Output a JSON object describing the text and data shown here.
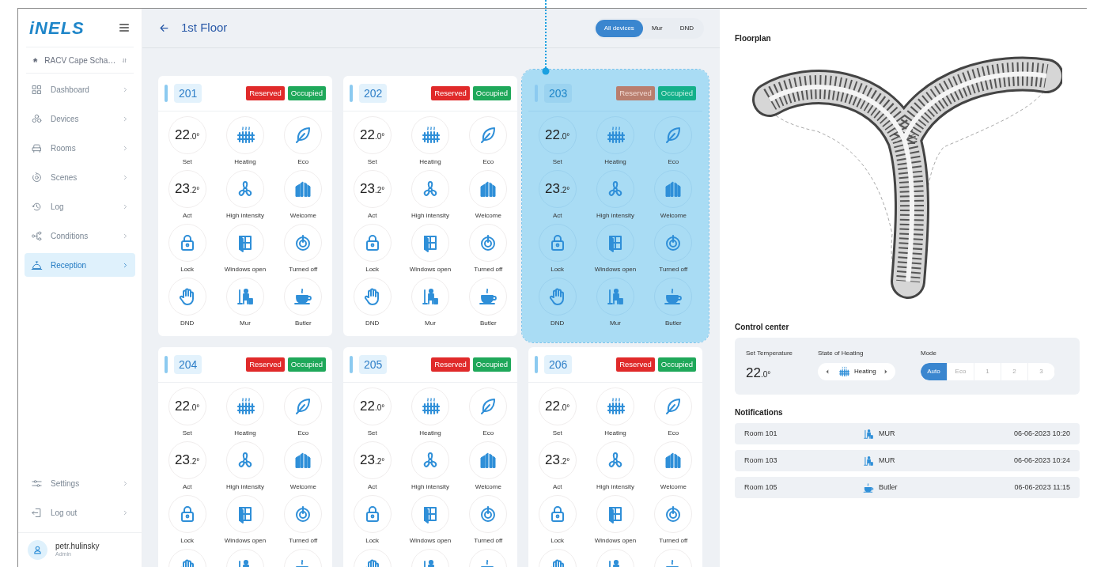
{
  "sidebar": {
    "logo": "iNELS",
    "site": "RACV Cape Scha…",
    "nav": [
      {
        "label": "Dashboard",
        "kind": "grid",
        "selected": false
      },
      {
        "label": "Devices",
        "kind": "devices",
        "selected": false
      },
      {
        "label": "Rooms",
        "kind": "armchair",
        "selected": false
      },
      {
        "label": "Scenes",
        "kind": "scenes",
        "selected": false
      },
      {
        "label": "Log",
        "kind": "clock",
        "selected": false
      },
      {
        "label": "Conditions",
        "kind": "nodes",
        "selected": false
      },
      {
        "label": "Reception",
        "kind": "bell",
        "selected": true
      }
    ],
    "bottom_nav": [
      {
        "label": "Settings",
        "kind": "sliders"
      },
      {
        "label": "Log out",
        "kind": "logout"
      }
    ],
    "user": {
      "name": "petr.hulinsky",
      "role": "Admin"
    }
  },
  "header": {
    "title": "1st Floor",
    "filters": [
      {
        "label": "All devices",
        "selected": true
      },
      {
        "label": "Mur",
        "selected": false
      },
      {
        "label": "DND",
        "selected": false
      }
    ]
  },
  "rooms": [
    {
      "number": "201",
      "highlighted": false,
      "badges": [
        {
          "label": "Reserved",
          "kind": "reserved"
        },
        {
          "label": "Occupied",
          "kind": "occupied"
        }
      ],
      "tiles": [
        {
          "kind": "temperature",
          "whole": "22",
          "fraction": ".0°",
          "label": "Set"
        },
        {
          "kind": "heating",
          "label": "Heating"
        },
        {
          "kind": "leaf",
          "label": "Eco"
        },
        {
          "kind": "temperature",
          "whole": "23",
          "fraction": ".2°",
          "label": "Act"
        },
        {
          "kind": "fan",
          "label": "High intensity"
        },
        {
          "kind": "doors",
          "label": "Welcome"
        },
        {
          "kind": "lock",
          "label": "Lock"
        },
        {
          "kind": "window",
          "label": "Windows open"
        },
        {
          "kind": "power",
          "label": "Turned off"
        },
        {
          "kind": "hand",
          "label": "DND"
        },
        {
          "kind": "mur",
          "label": "Mur"
        },
        {
          "kind": "cup",
          "label": "Butler"
        }
      ]
    },
    {
      "number": "202",
      "highlighted": false,
      "badges": [
        {
          "label": "Reserved",
          "kind": "reserved"
        },
        {
          "label": "Occupied",
          "kind": "occupied"
        }
      ],
      "tiles": [
        {
          "kind": "temperature",
          "whole": "22",
          "fraction": ".0°",
          "label": "Set"
        },
        {
          "kind": "heating",
          "label": "Heating"
        },
        {
          "kind": "leaf",
          "label": "Eco"
        },
        {
          "kind": "temperature",
          "whole": "23",
          "fraction": ".2°",
          "label": "Act"
        },
        {
          "kind": "fan",
          "label": "High intensity"
        },
        {
          "kind": "doors",
          "label": "Welcome"
        },
        {
          "kind": "lock",
          "label": "Lock"
        },
        {
          "kind": "window",
          "label": "Windows open"
        },
        {
          "kind": "power",
          "label": "Turned off"
        },
        {
          "kind": "hand",
          "label": "DND"
        },
        {
          "kind": "mur",
          "label": "Mur"
        },
        {
          "kind": "cup",
          "label": "Butler"
        }
      ]
    },
    {
      "number": "203",
      "highlighted": true,
      "badges": [
        {
          "label": "Reserved",
          "kind": "reserved"
        },
        {
          "label": "Occupied",
          "kind": "occupied"
        }
      ],
      "tiles": [
        {
          "kind": "temperature",
          "whole": "22",
          "fraction": ".0°",
          "label": "Set"
        },
        {
          "kind": "heating",
          "label": "Heating"
        },
        {
          "kind": "leaf",
          "label": "Eco"
        },
        {
          "kind": "temperature",
          "whole": "23",
          "fraction": ".2°",
          "label": "Act"
        },
        {
          "kind": "fan",
          "label": "High intensity"
        },
        {
          "kind": "doors",
          "label": "Welcome"
        },
        {
          "kind": "lock",
          "label": "Lock"
        },
        {
          "kind": "window",
          "label": "Windows open"
        },
        {
          "kind": "power",
          "label": "Turned off"
        },
        {
          "kind": "hand",
          "label": "DND"
        },
        {
          "kind": "mur",
          "label": "Mur"
        },
        {
          "kind": "cup",
          "label": "Butler"
        }
      ]
    },
    {
      "number": "204",
      "highlighted": false,
      "badges": [
        {
          "label": "Reserved",
          "kind": "reserved"
        },
        {
          "label": "Occupied",
          "kind": "occupied"
        }
      ],
      "tiles": [
        {
          "kind": "temperature",
          "whole": "22",
          "fraction": ".0°",
          "label": "Set"
        },
        {
          "kind": "heating",
          "label": "Heating"
        },
        {
          "kind": "leaf",
          "label": "Eco"
        },
        {
          "kind": "temperature",
          "whole": "23",
          "fraction": ".2°",
          "label": "Act"
        },
        {
          "kind": "fan",
          "label": "High intensity"
        },
        {
          "kind": "doors",
          "label": "Welcome"
        },
        {
          "kind": "lock",
          "label": "Lock"
        },
        {
          "kind": "window",
          "label": "Windows open"
        },
        {
          "kind": "power",
          "label": "Turned off"
        },
        {
          "kind": "hand"
        },
        {
          "kind": "mur"
        },
        {
          "kind": "cup"
        }
      ]
    },
    {
      "number": "205",
      "highlighted": false,
      "badges": [
        {
          "label": "Reserved",
          "kind": "reserved"
        },
        {
          "label": "Occupied",
          "kind": "occupied"
        }
      ],
      "tiles": [
        {
          "kind": "temperature",
          "whole": "22",
          "fraction": ".0°",
          "label": "Set"
        },
        {
          "kind": "heating",
          "label": "Heating"
        },
        {
          "kind": "leaf",
          "label": "Eco"
        },
        {
          "kind": "temperature",
          "whole": "23",
          "fraction": ".2°",
          "label": "Act"
        },
        {
          "kind": "fan",
          "label": "High intensity"
        },
        {
          "kind": "doors",
          "label": "Welcome"
        },
        {
          "kind": "lock",
          "label": "Lock"
        },
        {
          "kind": "window",
          "label": "Windows open"
        },
        {
          "kind": "power",
          "label": "Turned off"
        },
        {
          "kind": "hand"
        },
        {
          "kind": "mur"
        },
        {
          "kind": "cup"
        }
      ]
    },
    {
      "number": "206",
      "highlighted": false,
      "badges": [
        {
          "label": "Reserved",
          "kind": "reserved"
        },
        {
          "label": "Occupied",
          "kind": "occupied"
        }
      ],
      "tiles": [
        {
          "kind": "temperature",
          "whole": "22",
          "fraction": ".0°",
          "label": "Set"
        },
        {
          "kind": "heating",
          "label": "Heating"
        },
        {
          "kind": "leaf",
          "label": "Eco"
        },
        {
          "kind": "temperature",
          "whole": "23",
          "fraction": ".2°",
          "label": "Act"
        },
        {
          "kind": "fan",
          "label": "High intensity"
        },
        {
          "kind": "doors",
          "label": "Welcome"
        },
        {
          "kind": "lock",
          "label": "Lock"
        },
        {
          "kind": "window",
          "label": "Windows open"
        },
        {
          "kind": "power",
          "label": "Turned off"
        },
        {
          "kind": "hand"
        },
        {
          "kind": "mur"
        },
        {
          "kind": "cup"
        }
      ]
    }
  ],
  "floorplan": {
    "title": "Floorplan"
  },
  "control_center": {
    "title": "Control center",
    "set_temperature": {
      "label": "Set Temperature",
      "whole": "22",
      "fraction": ".0°"
    },
    "heating_state": {
      "label": "State of Heating",
      "value": "Heating"
    },
    "mode": {
      "label": "Mode",
      "options": [
        {
          "label": "Auto",
          "selected": true
        },
        {
          "label": "Eco",
          "selected": false
        },
        {
          "label": "1",
          "selected": false
        },
        {
          "label": "2",
          "selected": false
        },
        {
          "label": "3",
          "selected": false
        }
      ]
    }
  },
  "notifications": {
    "title": "Notifications",
    "items": [
      {
        "room": "Room 101",
        "kind": "mur",
        "type": "MUR",
        "time": "06-06-2023 10:20"
      },
      {
        "room": "Room 103",
        "kind": "mur",
        "type": "MUR",
        "time": "06-06-2023 10:24"
      },
      {
        "room": "Room 105",
        "kind": "cup",
        "type": "Butler",
        "time": "06-06-2023 11:15"
      }
    ]
  }
}
